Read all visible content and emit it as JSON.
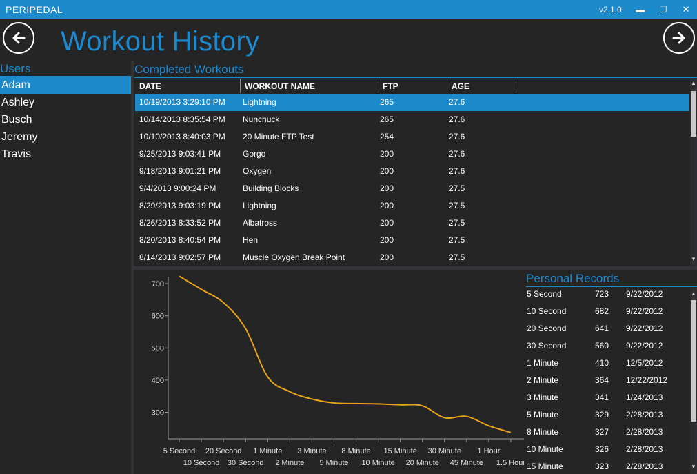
{
  "app": {
    "name": "PERIPEDAL",
    "version": "v2.1.0"
  },
  "window_controls": {
    "minimize": "▬",
    "maximize": "☐",
    "close": "✕"
  },
  "header": {
    "title": "Workout History",
    "back_icon": "arrow-left-icon",
    "forward_icon": "arrow-right-icon"
  },
  "users": {
    "heading": "Users",
    "items": [
      "Adam",
      "Ashley",
      "Busch",
      "Jeremy",
      "Travis"
    ],
    "selected": "Adam"
  },
  "workouts": {
    "heading": "Completed Workouts",
    "columns": [
      "DATE",
      "WORKOUT NAME",
      "FTP",
      "AGE"
    ],
    "rows": [
      {
        "date": "10/19/2013 3:29:10 PM",
        "name": "Lightning",
        "ftp": "265",
        "age": "27.6"
      },
      {
        "date": "10/14/2013 8:35:54 PM",
        "name": "Nunchuck",
        "ftp": "265",
        "age": "27.6"
      },
      {
        "date": "10/10/2013 8:40:03 PM",
        "name": "20 Minute FTP Test",
        "ftp": "254",
        "age": "27.6"
      },
      {
        "date": "9/25/2013 9:03:41 PM",
        "name": "Gorgo",
        "ftp": "200",
        "age": "27.6"
      },
      {
        "date": "9/18/2013 9:01:21 PM",
        "name": "Oxygen",
        "ftp": "200",
        "age": "27.6"
      },
      {
        "date": "9/4/2013 9:00:24 PM",
        "name": "Building Blocks",
        "ftp": "200",
        "age": "27.5"
      },
      {
        "date": "8/29/2013 9:03:19 PM",
        "name": "Lightning",
        "ftp": "200",
        "age": "27.5"
      },
      {
        "date": "8/26/2013 8:33:52 PM",
        "name": "Albatross",
        "ftp": "200",
        "age": "27.5"
      },
      {
        "date": "8/20/2013 8:40:54 PM",
        "name": "Hen",
        "ftp": "200",
        "age": "27.5"
      },
      {
        "date": "8/14/2013 9:02:57 PM",
        "name": "Muscle Oxygen Break Point",
        "ftp": "200",
        "age": "27.5"
      }
    ],
    "selected_index": 0
  },
  "chart_data": {
    "type": "line",
    "title": "",
    "xlabel": "",
    "ylabel": "",
    "categories": [
      "5 Second",
      "10 Second",
      "20 Second",
      "30 Second",
      "1 Minute",
      "2 Minute",
      "3 Minute",
      "5 Minute",
      "8 Minute",
      "10 Minute",
      "15 Minute",
      "20 Minute",
      "30 Minute",
      "45 Minute",
      "1 Hour",
      "1.5 Hour"
    ],
    "values": [
      723,
      682,
      641,
      560,
      410,
      364,
      341,
      329,
      327,
      326,
      323,
      320,
      283,
      287,
      258,
      237
    ],
    "y_ticks": [
      300,
      400,
      500,
      600,
      700
    ],
    "ylim": [
      240,
      730
    ],
    "line_color": "#e8a317",
    "grid": false
  },
  "records": {
    "heading": "Personal Records",
    "rows": [
      {
        "duration": "5 Second",
        "watts": "723",
        "date": "9/22/2012"
      },
      {
        "duration": "10 Second",
        "watts": "682",
        "date": "9/22/2012"
      },
      {
        "duration": "20 Second",
        "watts": "641",
        "date": "9/22/2012"
      },
      {
        "duration": "30 Second",
        "watts": "560",
        "date": "9/22/2012"
      },
      {
        "duration": "1 Minute",
        "watts": "410",
        "date": "12/5/2012"
      },
      {
        "duration": "2 Minute",
        "watts": "364",
        "date": "12/22/2012"
      },
      {
        "duration": "3 Minute",
        "watts": "341",
        "date": "1/24/2013"
      },
      {
        "duration": "5 Minute",
        "watts": "329",
        "date": "2/28/2013"
      },
      {
        "duration": "8 Minute",
        "watts": "327",
        "date": "2/28/2013"
      },
      {
        "duration": "10 Minute",
        "watts": "326",
        "date": "2/28/2013"
      },
      {
        "duration": "15 Minute",
        "watts": "323",
        "date": "2/28/2013"
      }
    ]
  },
  "colors": {
    "accent": "#1d8ad0",
    "background": "#252526",
    "selection": "#1c8acb"
  }
}
